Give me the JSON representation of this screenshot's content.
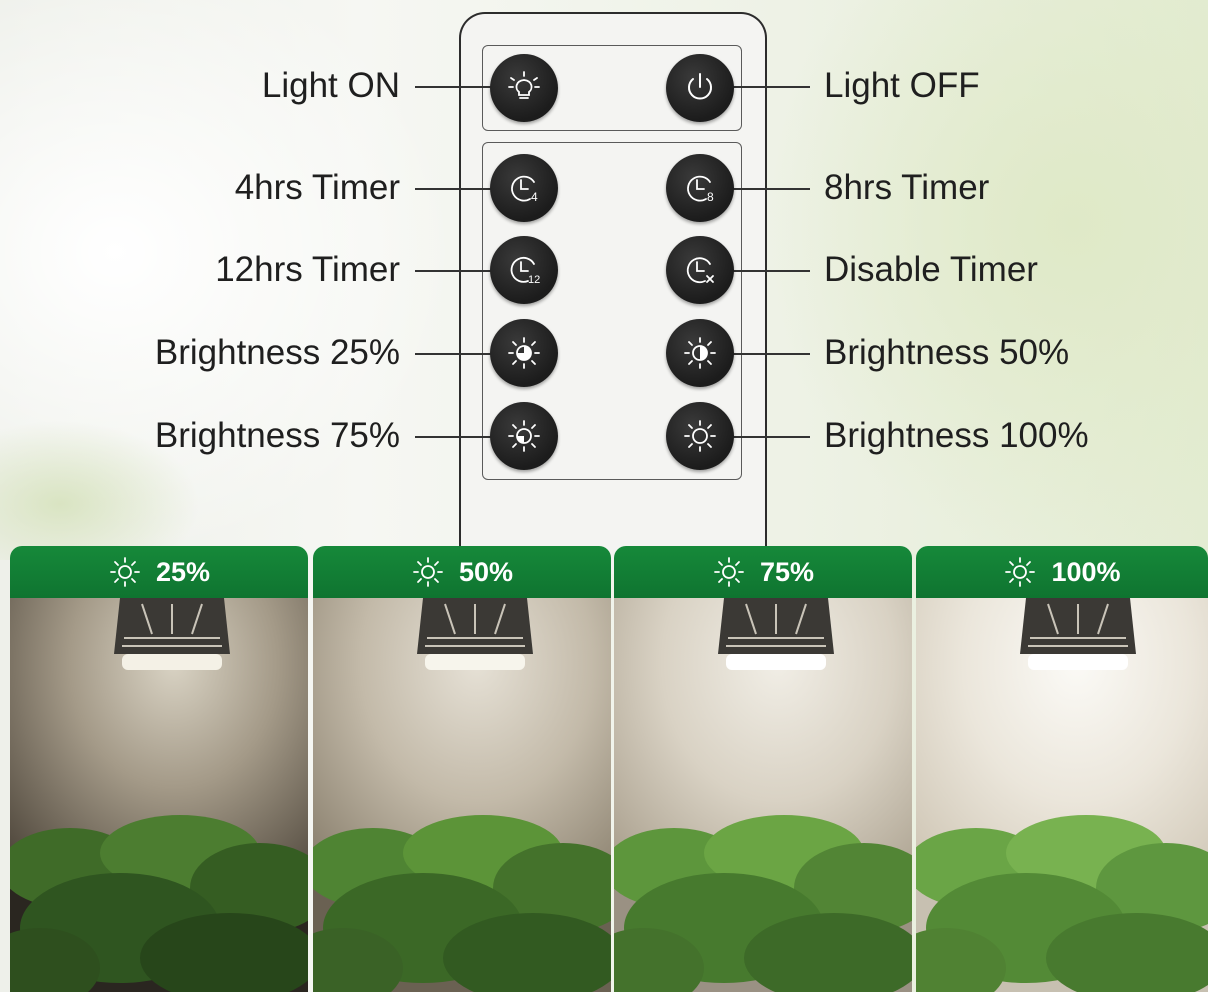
{
  "controls": {
    "light_on": "Light ON",
    "light_off": "Light OFF",
    "timer_4h": "4hrs Timer",
    "timer_8h": "8hrs Timer",
    "timer_12h": "12hrs Timer",
    "timer_disable": "Disable Timer",
    "brightness_25": "Brightness 25%",
    "brightness_50": "Brightness 50%",
    "brightness_75": "Brightness 75%",
    "brightness_100": "Brightness 100%"
  },
  "timer_badges": {
    "four": "4",
    "eight": "8",
    "twelve": "12"
  },
  "cards": [
    {
      "label": "25%"
    },
    {
      "label": "50%"
    },
    {
      "label": "75%"
    },
    {
      "label": "100%"
    }
  ],
  "colors": {
    "header_green": "#16893a",
    "button_dark": "#1c1c1c"
  }
}
